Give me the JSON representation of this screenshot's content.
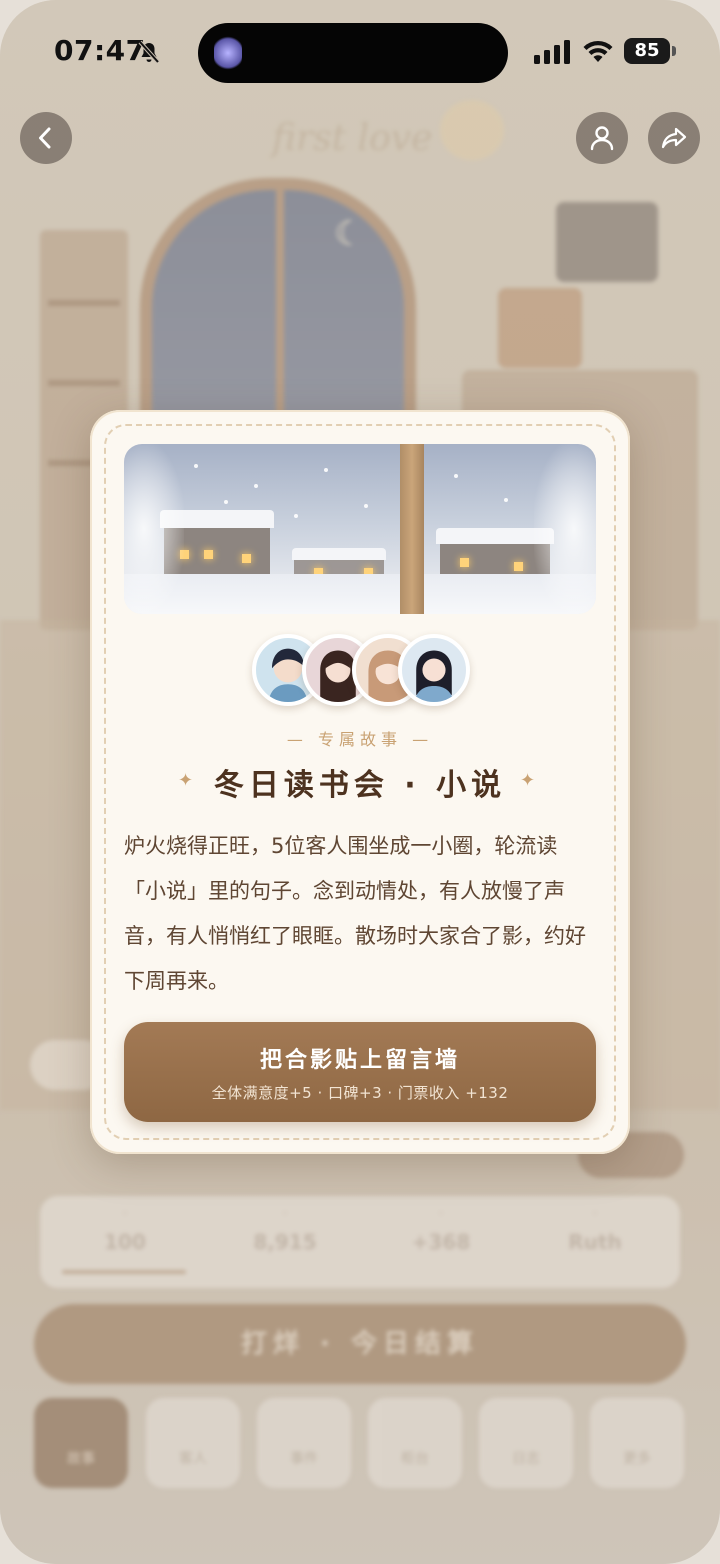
{
  "status_bar": {
    "time": "07:47",
    "battery": "85"
  },
  "background": {
    "ghost_title": "first love",
    "stats": [
      "100",
      "8,915",
      "+368",
      "Ruth"
    ],
    "big_button": "打烊 · 今日结算",
    "nav": [
      "故事",
      "客人",
      "事件",
      "柜台",
      "日志",
      "更多"
    ]
  },
  "modal": {
    "tag": "— 专属故事 —",
    "title": "冬日读书会 · 小说",
    "sparkle": "✦",
    "body": "炉火烧得正旺，5位客人围坐成一小圈，轮流读「小说」里的句子。念到动情处，有人放慢了声音，有人悄悄红了眼眶。散场时大家合了影，约好下周再来。",
    "cta": {
      "title": "把合影贴上留言墙",
      "subtitle": "全体满意度+5 · 口碑+3 · 门票收入 +132"
    }
  },
  "colors": {
    "accent": "#9a7350",
    "title": "#4d321f",
    "tag": "#c9a273",
    "card": "#fcf8f1"
  }
}
